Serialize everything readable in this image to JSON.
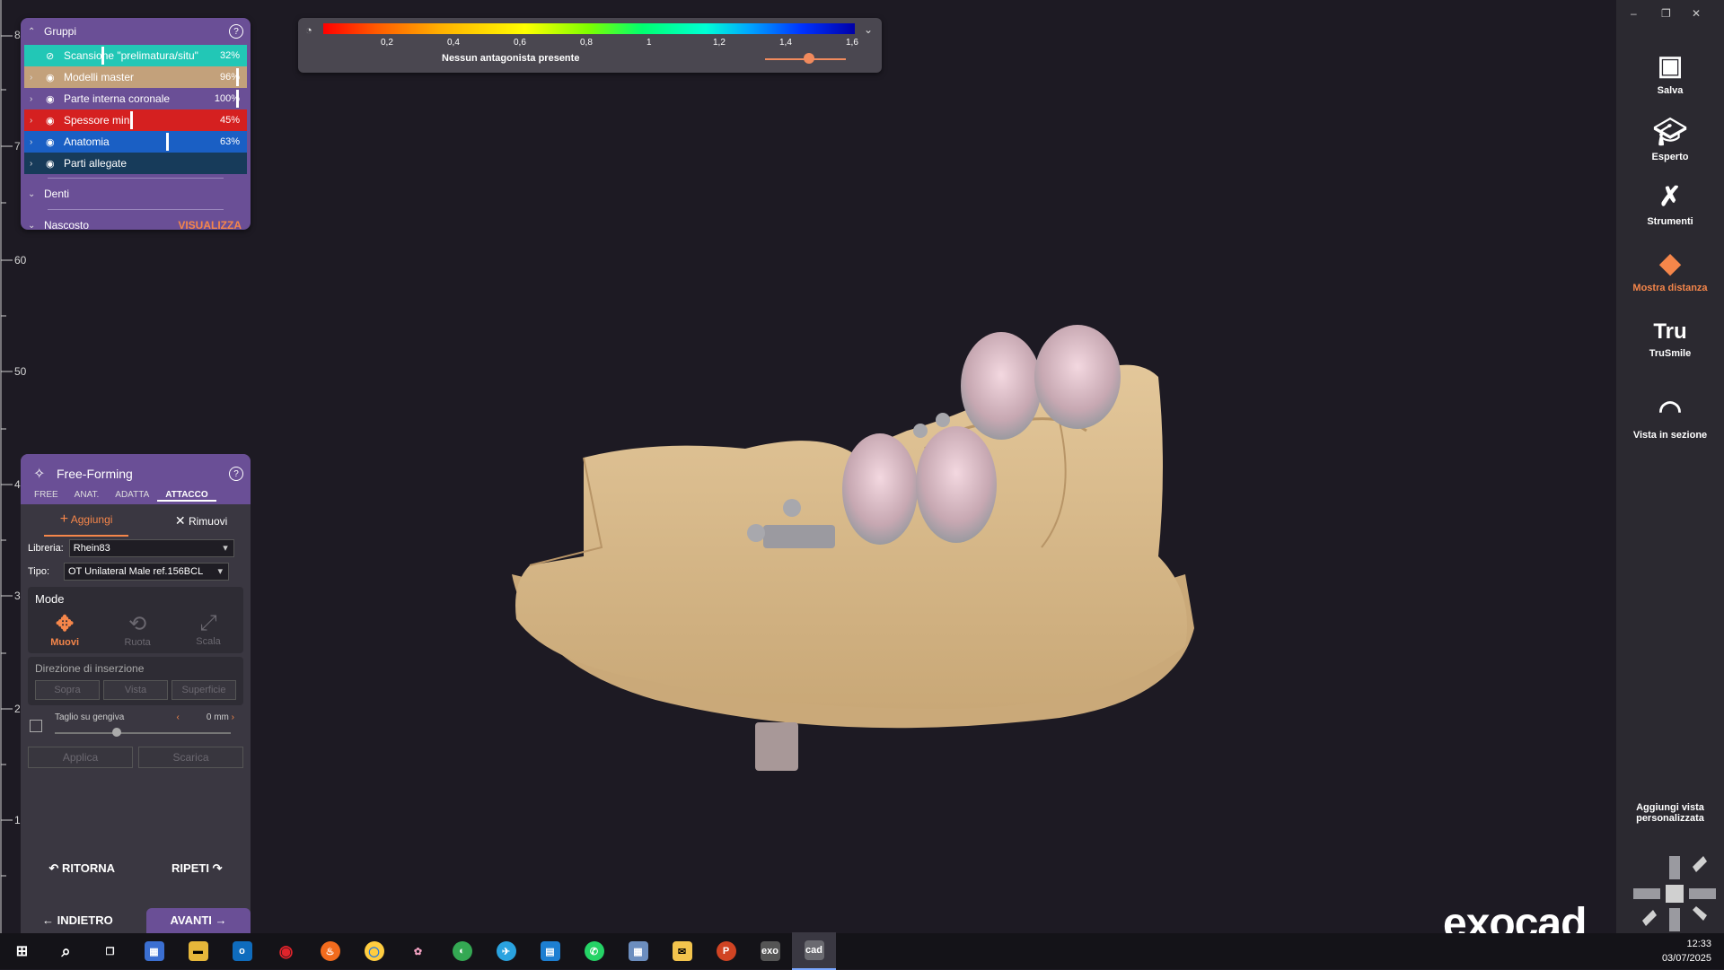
{
  "ruler": {
    "labels": [
      "8",
      "7",
      "60",
      "50",
      "4",
      "3",
      "2",
      "1"
    ]
  },
  "groups": {
    "title": "Gruppi",
    "items": [
      {
        "label": "Scansione \"prelimatura/situ\"",
        "pct": "32%",
        "bg": "#22c7b6",
        "hidden": true
      },
      {
        "label": "Modelli master",
        "pct": "96%",
        "bg": "#c3a17b"
      },
      {
        "label": "Parte interna coronale",
        "pct": "100%",
        "bg": "#6a4f96"
      },
      {
        "label": "Spessore min.",
        "pct": "45%",
        "bg": "#d52020"
      },
      {
        "label": "Anatomia",
        "pct": "63%",
        "bg": "#1a5fc4"
      },
      {
        "label": "Parti allegate",
        "pct": "",
        "bg": "#173b5a"
      }
    ],
    "denti": "Denti",
    "nascosto": "Nascosto",
    "visualizza": "VISUALIZZA"
  },
  "scale": {
    "ticks": [
      "0,2",
      "0,4",
      "0,6",
      "0,8",
      "1",
      "1,2",
      "1,4",
      "1,6"
    ],
    "message": "Nessun antagonista presente"
  },
  "freeforming": {
    "title": "Free-Forming",
    "tabs": [
      "FREE",
      "ANAT.",
      "ADATTA",
      "ATTACCO"
    ],
    "add": "Aggiungi",
    "remove": "Rimuovi",
    "library_label": "Libreria:",
    "library_value": "Rhein83",
    "type_label": "Tipo:",
    "type_value": "OT Unilateral Male ref.156BCL",
    "mode_title": "Mode",
    "modes": [
      "Muovi",
      "Ruota",
      "Scala"
    ],
    "direction_title": "Direzione di inserzione",
    "directions": [
      "Sopra",
      "Vista",
      "Superficie"
    ],
    "cut_label": "Taglio su gengiva",
    "cut_value": "0 mm",
    "apply": "Applica",
    "discard": "Scarica",
    "undo": "RITORNA",
    "redo": "RIPETI",
    "back": "INDIETRO",
    "next": "AVANTI"
  },
  "sidebar": {
    "items": [
      {
        "label": "Salva",
        "icon": "save-icon"
      },
      {
        "label": "Esperto",
        "icon": "expert-icon"
      },
      {
        "label": "Strumenti",
        "icon": "tools-icon"
      },
      {
        "label": "Mostra distanza",
        "icon": "distance-icon"
      },
      {
        "label": "TruSmile",
        "icon": "trusmile-icon"
      },
      {
        "label": "Vista in sezione",
        "icon": "section-view-icon"
      }
    ],
    "custom_view": "Aggiungi vista personalizzata",
    "accent": "#f5864a"
  },
  "logo": "exocad",
  "taskbar": {
    "apps": [
      "o",
      "◉",
      "♨",
      "◯",
      "✿",
      "◐",
      "✈",
      "▤",
      "✆",
      "▦",
      "✉",
      "P",
      "exo",
      "cad"
    ],
    "time": "12:33",
    "date": "03/07/2025"
  }
}
